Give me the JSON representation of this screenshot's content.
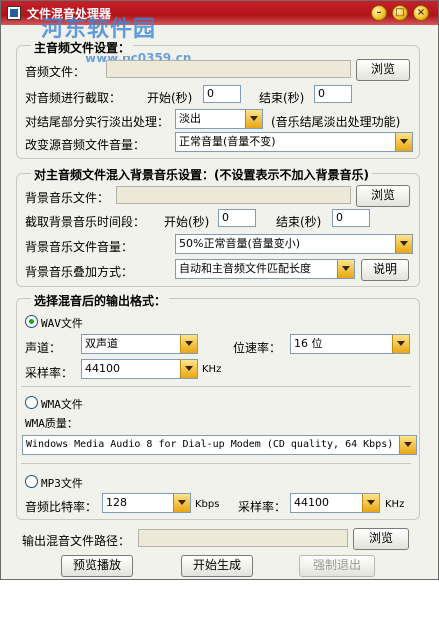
{
  "title": "文件混音处理器",
  "watermark": {
    "logo": "河东软件园",
    "url": "www.pc0359.cn"
  },
  "main": {
    "legend": "主音频文件设置：",
    "file_label": "音频文件：",
    "browse": "浏览",
    "trim_label": "对音频进行截取：",
    "start_label": "开始(秒)",
    "start_value": "0",
    "end_label": "结束(秒)",
    "end_value": "0",
    "fade_label": "对结尾部分实行淡出处理：",
    "fade_value": "淡出",
    "fade_note": "(音乐结尾淡出处理功能)",
    "volume_label": "改变源音频文件音量：",
    "volume_value": "正常音量(音量不变)"
  },
  "bg": {
    "legend": "对主音频文件混入背景音乐设置：(不设置表示不加入背景音乐)",
    "file_label": "背景音乐文件：",
    "browse": "浏览",
    "trim_label": "截取背景音乐时间段：",
    "start_label": "开始(秒)",
    "start_value": "0",
    "end_label": "结束(秒)",
    "end_value": "0",
    "volume_label": "背景音乐文件音量：",
    "volume_value": "50%正常音量(音量变小)",
    "mix_label": "背景音乐叠加方式：",
    "mix_value": "自动和主音频文件匹配长度",
    "explain": "说明"
  },
  "output": {
    "legend": "选择混音后的输出格式：",
    "wav_label": "WAV文件",
    "channel_label": "声道：",
    "channel_value": "双声道",
    "bitdepth_label": "位速率：",
    "bitdepth_value": "16 位",
    "samplerate_label": "采样率：",
    "samplerate_value": "44100",
    "khz": "KHz",
    "wma_label": "WMA文件",
    "wma_quality_label": "WMA质量：",
    "wma_quality_value": "Windows Media Audio 8 for Dial-up Modem (CD quality, 64 Kbps)",
    "mp3_label": "MP3文件",
    "mp3_bitrate_label": "音频比特率：",
    "mp3_bitrate_value": "128",
    "kbps": "Kbps",
    "mp3_samplerate_label": "采样率：",
    "mp3_samplerate_value": "44100",
    "mp3_khz": "KHz"
  },
  "footer": {
    "path_label": "输出混音文件路径：",
    "browse": "浏览",
    "preview": "预览播放",
    "start": "开始生成",
    "stop": "强制退出"
  }
}
